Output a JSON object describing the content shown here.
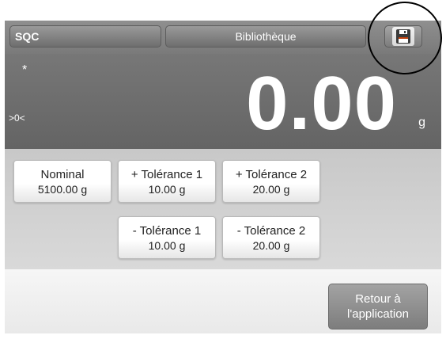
{
  "header": {
    "app_name": "SQC",
    "library_label": "Bibliothèque",
    "save_icon": "floppy-disk-icon"
  },
  "display": {
    "stable_indicator": "*",
    "zero_indicator": ">0<",
    "weight": "0.00",
    "unit": "g"
  },
  "references": {
    "nominal": {
      "label": "Nominal",
      "value": "5100.00 g"
    },
    "plus_tol_1": {
      "label": "+ Tolérance 1",
      "value": "10.00 g"
    },
    "plus_tol_2": {
      "label": "+ Tolérance 2",
      "value": "20.00 g"
    },
    "minus_tol_1": {
      "label": "- Tolérance 1",
      "value": "10.00 g"
    },
    "minus_tol_2": {
      "label": "- Tolérance 2",
      "value": "20.00 g"
    }
  },
  "footer": {
    "back_line1": "Retour à",
    "back_line2": "l'application"
  },
  "colors": {
    "header": "#7f7f7f",
    "display": "#6e6e6e",
    "reference_area": "#d0d0d0",
    "button": "#8e8e8e",
    "disk_accent": "#c2410c"
  }
}
